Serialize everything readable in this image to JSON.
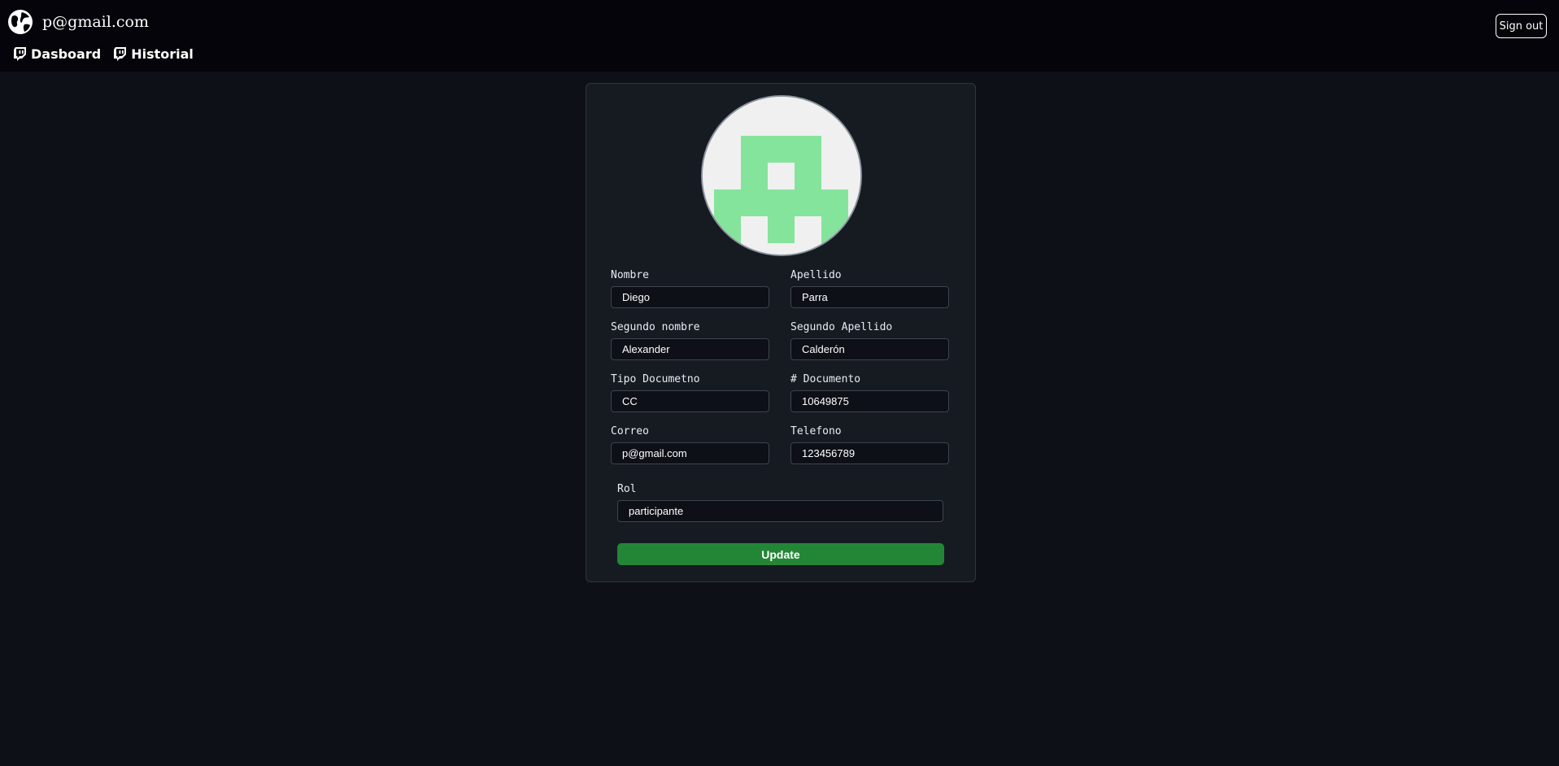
{
  "header": {
    "user_email": "p@gmail.com",
    "nav": [
      {
        "label": "Dasboard",
        "icon": "twitch-icon"
      },
      {
        "label": "Historial",
        "icon": "twitch-icon"
      }
    ],
    "signout_label": "Sign out"
  },
  "profile": {
    "avatar": {
      "icon": "identicon-avatar",
      "color": "#84e49c",
      "background": "#f0f0f0"
    },
    "fields": {
      "nombre": {
        "label": "Nombre",
        "value": "Diego"
      },
      "apellido": {
        "label": "Apellido",
        "value": "Parra"
      },
      "segundo_nombre": {
        "label": "Segundo nombre",
        "value": "Alexander"
      },
      "segundo_apellido": {
        "label": "Segundo Apellido",
        "value": "Calderón"
      },
      "tipo_documento": {
        "label": "Tipo Documetno",
        "value": "CC"
      },
      "documento": {
        "label": "# Documento",
        "value": "10649875"
      },
      "correo": {
        "label": "Correo",
        "value": "p@gmail.com"
      },
      "telefono": {
        "label": "Telefono",
        "value": "123456789"
      },
      "rol": {
        "label": "Rol",
        "value": "participante"
      }
    },
    "update_label": "Update"
  },
  "colors": {
    "topbar": "#05040a",
    "background": "#0d1117",
    "card": "#161b22",
    "button": "#238636"
  }
}
